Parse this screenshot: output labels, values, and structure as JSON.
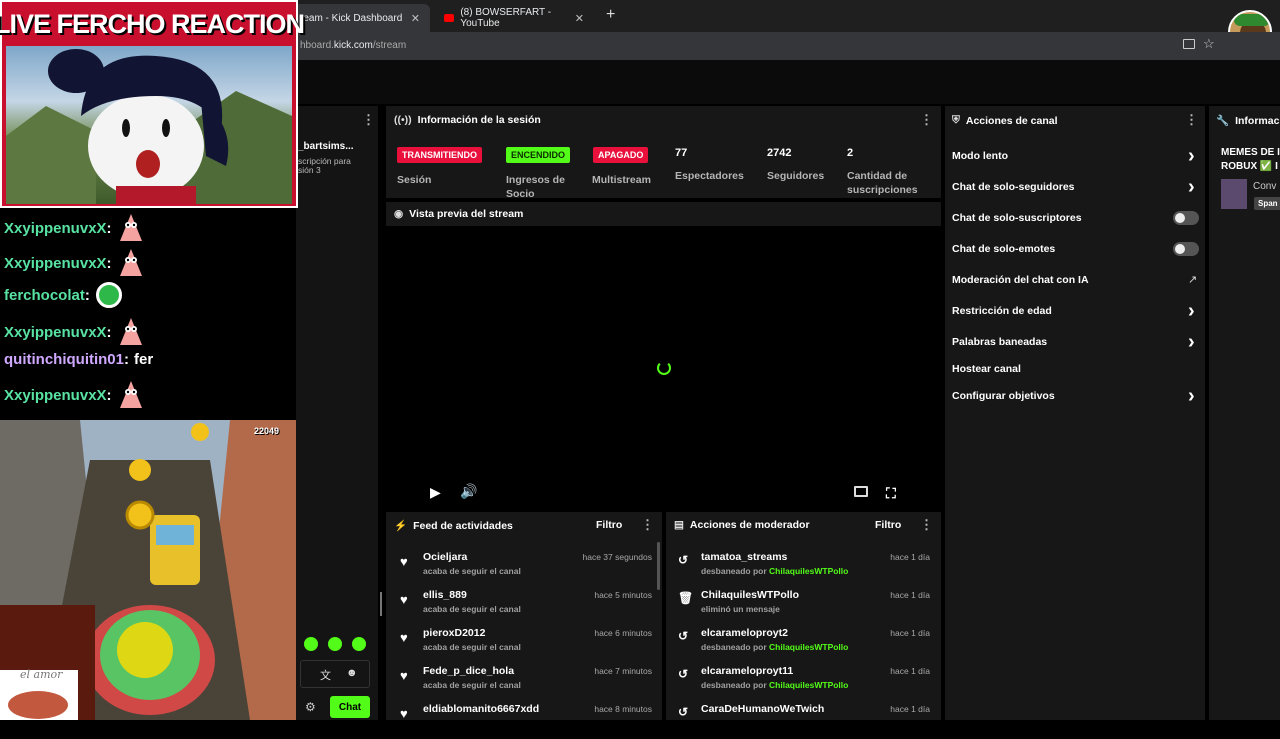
{
  "browser": {
    "tabs": [
      {
        "title": "ream - Kick Dashboard",
        "close": "✕"
      },
      {
        "title": "(8) BOWSERFART - YouTube",
        "close": "✕"
      }
    ],
    "new_tab": "+",
    "url_prefix": "hboard.",
    "url_domain": "kick.com",
    "url_path": "/stream"
  },
  "overlay": {
    "title": "LIVE FERCHO REACTION",
    "chat": [
      {
        "user": "XxyippenuvxX",
        "text": ""
      },
      {
        "user": "XxyippenuvxX",
        "text": ""
      },
      {
        "user": "ferchocolat",
        "text": ""
      },
      {
        "user": "XxyippenuvxX",
        "text": ""
      },
      {
        "user": "quitinchiquitin01",
        "text": "fer"
      },
      {
        "user": "XxyippenuvxX",
        "text": ""
      }
    ],
    "game_score": "22049",
    "signature": "el amor"
  },
  "left_panel": {
    "channel_name": "_bartsims...",
    "channel_sub1": "scripción para",
    "channel_sub2": "sión 3",
    "chat_button": "Chat"
  },
  "session": {
    "title": "Información de la sesión",
    "badges": [
      {
        "label": "TRANSMITIENDO",
        "caption": "Sesión",
        "color": "#e9113c",
        "text_color": "#ffffff"
      },
      {
        "label": "ENCENDIDO",
        "caption": "Ingresos de Socio",
        "color": "#53fc18",
        "text_color": "#0b2d00"
      },
      {
        "label": "APAGADO",
        "caption": "Multistream",
        "color": "#e9113c",
        "text_color": "#ffffff"
      }
    ],
    "stats": [
      {
        "value": "77",
        "label": "Espectadores"
      },
      {
        "value": "2742",
        "label": "Seguidores"
      },
      {
        "value": "2",
        "label": "Cantidad de suscripciones"
      }
    ]
  },
  "preview": {
    "title": "Vista previa del stream"
  },
  "activity": {
    "title": "Feed de actividades",
    "filter": "Filtro",
    "rows": [
      {
        "name": "Ocieljara",
        "sub": "acaba de seguir el canal",
        "time": "hace 37 segundos"
      },
      {
        "name": "ellis_889",
        "sub": "acaba de seguir el canal",
        "time": "hace 5 minutos"
      },
      {
        "name": "pieroxD2012",
        "sub": "acaba de seguir el canal",
        "time": "hace 6 minutos"
      },
      {
        "name": "Fede_p_dice_hola",
        "sub": "acaba de seguir el canal",
        "time": "hace 7 minutos"
      },
      {
        "name": "eldiablomanito6667xdd",
        "sub": "",
        "time": "hace 8 minutos"
      }
    ]
  },
  "moderator": {
    "title": "Acciones de moderador",
    "filter": "Filtro",
    "by": "ChilaquilesWTPollo",
    "rows": [
      {
        "name": "tamatoa_streams",
        "action": "desbaneado por ",
        "time": "hace 1 día",
        "icon": "undo-icon"
      },
      {
        "name": "ChilaquilesWTPollo",
        "action": "eliminó un mensaje",
        "time": "hace 1 día",
        "icon": "trash-icon"
      },
      {
        "name": "elcarameloproyt2",
        "action": "desbaneado por ",
        "time": "hace 1 día",
        "icon": "undo-icon"
      },
      {
        "name": "elcarameloproyt11",
        "action": "desbaneado por ",
        "time": "hace 1 día",
        "icon": "undo-icon"
      },
      {
        "name": "CaraDeHumanoWeTwich",
        "action": "",
        "time": "hace 1 día",
        "icon": "undo-icon"
      }
    ]
  },
  "channel_actions": {
    "title": "Acciones de canal",
    "items": [
      {
        "label": "Modo lento",
        "control": "chevron"
      },
      {
        "label": "Chat de solo-seguidores",
        "control": "chevron"
      },
      {
        "label": "Chat de solo-suscriptores",
        "control": "toggle"
      },
      {
        "label": "Chat de solo-emotes",
        "control": "toggle"
      },
      {
        "label": "Moderación del chat con IA",
        "control": "external"
      },
      {
        "label": "Restricción de edad",
        "control": "chevron"
      },
      {
        "label": "Palabras baneadas",
        "control": "chevron"
      },
      {
        "label": "Hostear canal",
        "control": "none"
      },
      {
        "label": "Configurar objetivos",
        "control": "chevron"
      }
    ]
  },
  "info_panel": {
    "title": "Informaci",
    "line1": "MEMES DE I",
    "line2": "ROBUX ✅ I",
    "item": "Conv",
    "tag": "Span"
  }
}
